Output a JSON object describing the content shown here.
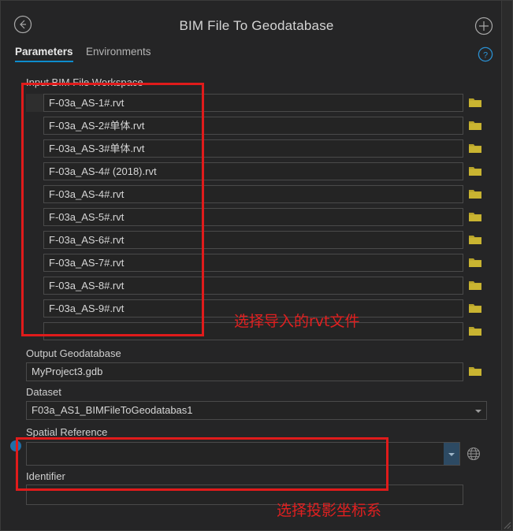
{
  "window": {
    "title": "BIM File To Geodatabase",
    "back_icon": "back-arrow-icon",
    "add_icon": "plus-circle-icon",
    "help_icon": "help-circle-icon"
  },
  "tabs": [
    {
      "label": "Parameters",
      "active": true
    },
    {
      "label": "Environments",
      "active": false
    }
  ],
  "parameters": {
    "input_workspace": {
      "label": "Input BIM File Workspace",
      "browse_icon": "folder-icon",
      "rows": [
        {
          "value": "F-03a_AS-1#.rvt"
        },
        {
          "value": "F-03a_AS-2#单体.rvt"
        },
        {
          "value": "F-03a_AS-3#单体.rvt"
        },
        {
          "value": "F-03a_AS-4# (2018).rvt"
        },
        {
          "value": "F-03a_AS-4#.rvt"
        },
        {
          "value": "F-03a_AS-5#.rvt"
        },
        {
          "value": "F-03a_AS-6#.rvt"
        },
        {
          "value": "F-03a_AS-7#.rvt"
        },
        {
          "value": "F-03a_AS-8#.rvt"
        },
        {
          "value": "F-03a_AS-9#.rvt"
        },
        {
          "value": ""
        }
      ]
    },
    "output_geodatabase": {
      "label": "Output Geodatabase",
      "value": "MyProject3.gdb",
      "browse_icon": "folder-icon"
    },
    "dataset": {
      "label": "Dataset",
      "value": "F03a_AS1_BIMFileToGeodatabas1"
    },
    "spatial_reference": {
      "label": "Spatial Reference",
      "value": "",
      "globe_icon": "globe-icon",
      "dropdown_icon": "chevron-down-icon"
    },
    "identifier": {
      "label": "Identifier",
      "value": ""
    }
  },
  "annotations": [
    {
      "text": "选择导入的rvt文件"
    },
    {
      "text": "选择投影坐标系"
    }
  ],
  "colors": {
    "accent_blue": "#0d8ccd",
    "annotation_red": "#e02020",
    "folder_yellow": "#b5a12a",
    "panel_bg": "#252526",
    "input_bg": "#242424"
  }
}
